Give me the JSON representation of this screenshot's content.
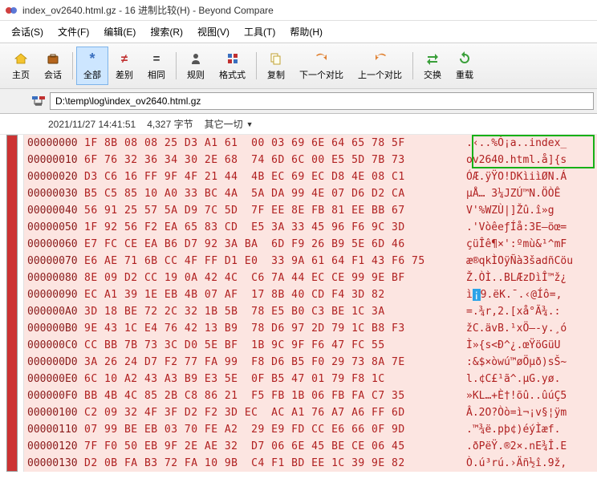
{
  "window": {
    "title": "index_ov2640.html.gz - 16 进制比较(H) - Beyond Compare"
  },
  "menu": {
    "session": "会话(S)",
    "file": "文件(F)",
    "edit": "编辑(E)",
    "search": "搜索(R)",
    "view": "视图(V)",
    "tools": "工具(T)",
    "help": "帮助(H)"
  },
  "toolbar": {
    "home": "主页",
    "session": "会话",
    "all": "全部",
    "diff": "差别",
    "same": "相同",
    "rules": "规则",
    "format": "格式式",
    "copy": "复制",
    "next_diff": "下一个对比",
    "prev_diff": "上一个对比",
    "swap": "交换",
    "reload": "重载"
  },
  "address": {
    "path": "D:\\temp\\log\\index_ov2640.html.gz"
  },
  "info": {
    "timestamp": "2021/11/27 14:41:51",
    "size": "4,327 字节",
    "other": "其它一切"
  },
  "icons": {
    "logo": "app-logo",
    "home": "⌂",
    "briefcase": "💼",
    "star": "*",
    "noteq": "≠",
    "eq": "=",
    "person": "👤",
    "grid": "▦",
    "copy": "⎘",
    "next": "↷",
    "prev": "↶",
    "swap": "⇄",
    "reload": "⟳",
    "treeicon": "▸"
  },
  "hex": {
    "rows": [
      {
        "o": "00000000",
        "h": "1F 8B 08 08 25 D3 A1 61  00 03 69 6E 64 65 78 5F",
        "a": ".‹..%Ó¡a..index_"
      },
      {
        "o": "00000010",
        "h": "6F 76 32 36 34 30 2E 68  74 6D 6C 00 E5 5D 7B 73",
        "a": "ov2640.html.å]{s"
      },
      {
        "o": "00000020",
        "h": "D3 C6 16 FF 9F 4F 21 44  4B EC 69 EC D8 4E 08 C1",
        "a": "ÓÆ.ÿŸO!DKìiìØN.Á"
      },
      {
        "o": "00000030",
        "h": "B5 C5 85 10 A0 33 BC 4A  5A DA 99 4E 07 D6 D2 CA",
        "a": "µÅ… 3¼JZÚ™N.ÖÒÊ"
      },
      {
        "o": "00000040",
        "h": "56 91 25 57 5A D9 7C 5D  7F EE 8E FB 81 EE BB 67",
        "a": "V'%WZÙ|]Žû.î»g"
      },
      {
        "o": "00000050",
        "h": "1F 92 56 F2 EA 65 83 CD  E5 3A 33 45 96 F6 9C 3D",
        "a": ".'VòêeƒÍå:3E–öœ="
      },
      {
        "o": "00000060",
        "h": "E7 FC CE EA B6 D7 92 3A BA  6D F9 26 B9 5E 6D 46",
        "a": "çüÎê¶×':ºmù&¹^mF"
      },
      {
        "o": "00000070",
        "h": "E6 AE 71 6B CC 4F FF D1 E0  33 9A 61 64 F1 43 F6 75",
        "a": "æ®qkÌOÿÑà3šadñCöu"
      },
      {
        "o": "00000080",
        "h": "8E 09 D2 CC 19 0A 42 4C  C6 7A 44 EC CE 99 9E BF",
        "a": "Ž.ÒÌ..BLÆzDìÎ™ž¿"
      },
      {
        "o": "00000090",
        "h": "EC A1 39 1E EB 4B 07 AF  17 8B 40 CD F4 3D 82",
        "a": "ì¡9.ëK.¯.‹@Íô=‚"
      },
      {
        "o": "000000A0",
        "h": "3D 18 BE 72 2C 32 1B 5B  78 E5 B0 C3 BE 1C 3A",
        "a": "=.¾r,2.[xå°Ã¾.:"
      },
      {
        "o": "000000B0",
        "h": "9E 43 1C E4 76 42 13 B9  78 D6 97 2D 79 1C B8 F3",
        "a": "žC.ävB.¹xÖ—-y.¸ó"
      },
      {
        "o": "000000C0",
        "h": "CC BB 7B 73 3C D0 5E BF  1B 9C 9F F6 47 FC 55",
        "a": "Ì»{s<Ð^¿.œŸöGüU"
      },
      {
        "o": "000000D0",
        "h": "3A 26 24 D7 F2 77 FA 99  F8 D6 B5 F0 29 73 8A 7E",
        "a": ":&$×òwú™øÖµð)sŠ~"
      },
      {
        "o": "000000E0",
        "h": "6C 10 A2 43 A3 B9 E3 5E  0F B5 47 01 79 F8 1C",
        "a": "l.¢C£¹ã^.µG.yø."
      },
      {
        "o": "000000F0",
        "h": "BB 4B 4C 85 2B C8 86 21  F5 FB 1B 06 FB FA C7 35",
        "a": "»KL…+È†!õû..ûúÇ5"
      },
      {
        "o": "00000100",
        "h": "C2 09 32 4F 3F D2 F2 3D EC  AC A1 76 A7 A6 FF 6D",
        "a": "Â.2O?Òò=ì¬¡v§¦ÿm"
      },
      {
        "o": "00000110",
        "h": "07 99 BE EB 03 70 FE A2  29 E9 FD CC E6 66 0F 9D",
        "a": ".™¾ë.pþ¢)éýÌæf."
      },
      {
        "o": "00000120",
        "h": "7F F0 50 EB 9F 2E AE 32  D7 06 6E 45 BE CE 06 45",
        "a": ".ðPëŸ.®2×.nE¾Î.E"
      },
      {
        "o": "00000130",
        "h": "D2 0B FA B3 72 FA 10 9B  C4 F1 BD EE 1C 39 9E 82",
        "a": "Ò.ú³rú.›Äñ½î.9ž‚"
      }
    ]
  }
}
